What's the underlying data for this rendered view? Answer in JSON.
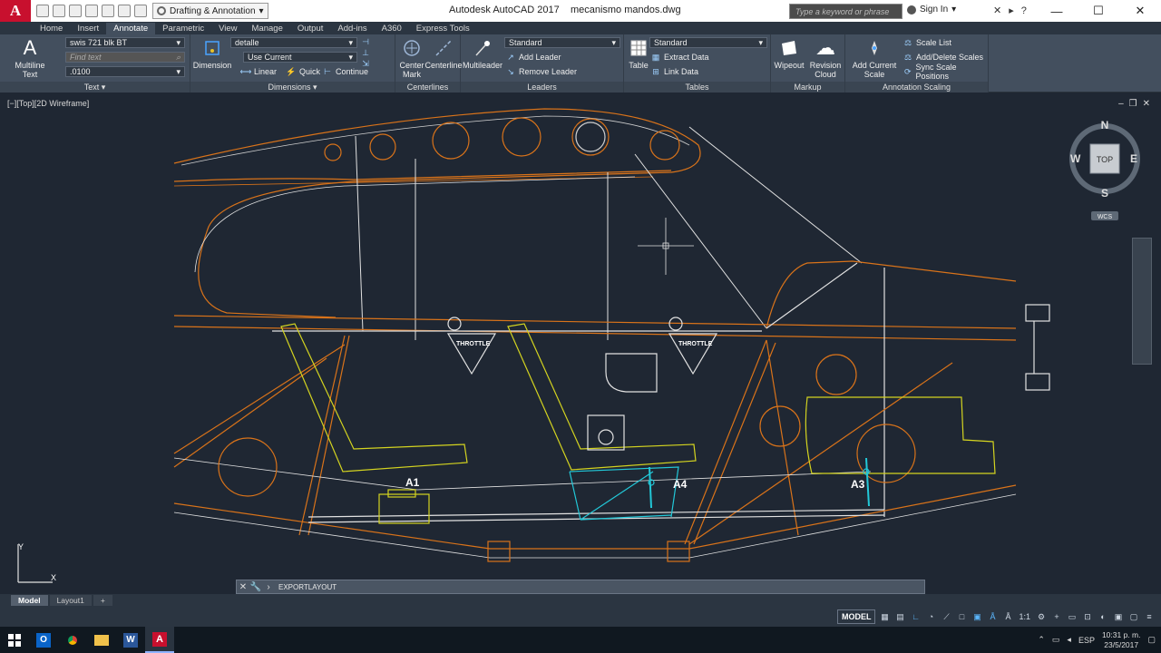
{
  "titlebar": {
    "logo": "A",
    "workspace": "Drafting & Annotation",
    "app_title": "Autodesk AutoCAD 2017",
    "file_name": "mecanismo mandos.dwg",
    "search_placeholder": "Type a keyword or phrase",
    "signin": "Sign In"
  },
  "ribbon_tabs": [
    "Home",
    "Insert",
    "Annotate",
    "Parametric",
    "View",
    "Manage",
    "Output",
    "Add-ins",
    "A360",
    "Express Tools"
  ],
  "active_tab": "Annotate",
  "ribbon": {
    "text_panel": {
      "multiline_text": "Multiline Text",
      "style_value": "swis 721 blk BT",
      "find_placeholder": "Find text",
      "height_value": ".0100",
      "title": "Text"
    },
    "dimensions_panel": {
      "dimension_label": "Dimension",
      "dimstyle_value": "detalle",
      "layer_value": "Use Current",
      "linear": "Linear",
      "quick": "Quick",
      "continue": "Continue",
      "title": "Dimensions"
    },
    "centerlines_panel": {
      "center_mark": "Center Mark",
      "centerline": "Centerline",
      "title": "Centerlines"
    },
    "leaders_panel": {
      "multileader": "Multileader",
      "style_value": "Standard",
      "add_leader": "Add Leader",
      "remove_leader": "Remove Leader",
      "title": "Leaders"
    },
    "tables_panel": {
      "table": "Table",
      "style_value": "Standard",
      "extract_data": "Extract Data",
      "link_data": "Link Data",
      "title": "Tables"
    },
    "markup_panel": {
      "wipeout": "Wipeout",
      "revision_cloud": "Revision Cloud",
      "title": "Markup"
    },
    "scaling_panel": {
      "add_current_scale": "Add Current Scale",
      "scale_list": "Scale List",
      "add_delete_scales": "Add/Delete Scales",
      "sync_scale_positions": "Sync Scale Positions",
      "title": "Annotation Scaling"
    }
  },
  "viewport": {
    "label": "[−][Top][2D Wireframe]",
    "labels": {
      "a1": "A1",
      "a4": "A4",
      "a3": "A3",
      "throttle": "THROTTLE",
      "throttle2": "THROTTLE",
      "ucs_y": "Y",
      "ucs_x": "X"
    }
  },
  "viewcube": {
    "north": "N",
    "south": "S",
    "east": "E",
    "west": "W",
    "top": "TOP",
    "wcs": "WCS"
  },
  "command_line": {
    "text": "EXPORTLAYOUT"
  },
  "layout_tabs": [
    "Model",
    "Layout1"
  ],
  "active_layout": "Model",
  "statusbar": {
    "model": "MODEL",
    "scale": "1:1"
  },
  "taskbar": {
    "lang": "ESP",
    "time": "10:31 p. m.",
    "date": "23/5/2017"
  },
  "colors": {
    "orange": "#d9731a",
    "yellow": "#d4d420",
    "cyan": "#22c8d8",
    "white": "#e8e8e8",
    "background": "#1f2733"
  }
}
